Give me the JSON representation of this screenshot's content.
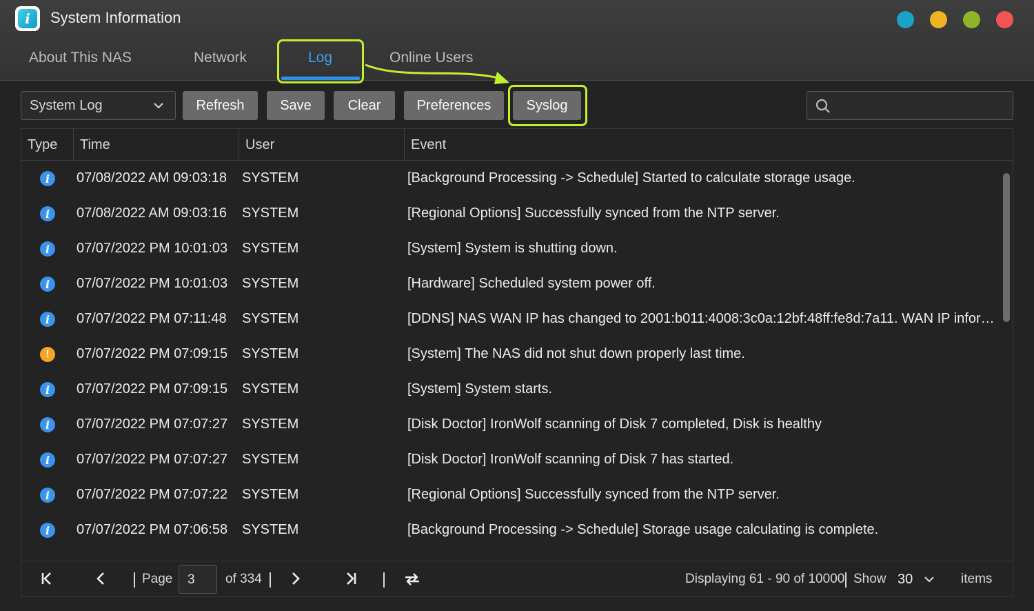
{
  "window": {
    "title": "System Information",
    "controls": [
      {
        "name": "help",
        "color": "#1aa3c7"
      },
      {
        "name": "minimize",
        "color": "#f0b323"
      },
      {
        "name": "maximize",
        "color": "#8fb427"
      },
      {
        "name": "close",
        "color": "#f05454"
      }
    ]
  },
  "tabs": [
    {
      "label": "About This NAS",
      "active": false
    },
    {
      "label": "Network",
      "active": false
    },
    {
      "label": "Log",
      "active": true
    },
    {
      "label": "Online Users",
      "active": false
    }
  ],
  "toolbar": {
    "log_type": "System Log",
    "refresh": "Refresh",
    "save": "Save",
    "clear": "Clear",
    "preferences": "Preferences",
    "syslog": "Syslog",
    "search_placeholder": ""
  },
  "table": {
    "columns": [
      "Type",
      "Time",
      "User",
      "Event"
    ],
    "rows": [
      {
        "type": "info",
        "time": "07/08/2022 AM 09:03:18",
        "user": "SYSTEM",
        "event": "[Background Processing -> Schedule] Started to calculate storage usage."
      },
      {
        "type": "info",
        "time": "07/08/2022 AM 09:03:16",
        "user": "SYSTEM",
        "event": "[Regional Options] Successfully synced from the NTP server."
      },
      {
        "type": "info",
        "time": "07/07/2022 PM 10:01:03",
        "user": "SYSTEM",
        "event": "[System] System is shutting down."
      },
      {
        "type": "info",
        "time": "07/07/2022 PM 10:01:03",
        "user": "SYSTEM",
        "event": "[Hardware] Scheduled system power off."
      },
      {
        "type": "info",
        "time": "07/07/2022 PM 07:11:48",
        "user": "SYSTEM",
        "event": "[DDNS] NAS WAN IP has changed to 2001:b011:4008:3c0a:12bf:48ff:fe8d:7a11. WAN IP informatio..."
      },
      {
        "type": "warning",
        "time": "07/07/2022 PM 07:09:15",
        "user": "SYSTEM",
        "event": "[System] The NAS did not shut down properly last time."
      },
      {
        "type": "info",
        "time": "07/07/2022 PM 07:09:15",
        "user": "SYSTEM",
        "event": "[System] System starts."
      },
      {
        "type": "info",
        "time": "07/07/2022 PM 07:07:27",
        "user": "SYSTEM",
        "event": "[Disk Doctor] IronWolf scanning of Disk 7 completed, Disk is healthy"
      },
      {
        "type": "info",
        "time": "07/07/2022 PM 07:07:27",
        "user": "SYSTEM",
        "event": "[Disk Doctor] IronWolf scanning of Disk 7 has started."
      },
      {
        "type": "info",
        "time": "07/07/2022 PM 07:07:22",
        "user": "SYSTEM",
        "event": "[Regional Options] Successfully synced from the NTP server."
      },
      {
        "type": "info",
        "time": "07/07/2022 PM 07:06:58",
        "user": "SYSTEM",
        "event": "[Background Processing -> Schedule] Storage usage calculating is complete."
      }
    ]
  },
  "pagination": {
    "page_label": "Page",
    "page": "3",
    "of_label": "of 334",
    "displaying": "Displaying 61 - 90 of 10000",
    "show_label": "Show",
    "show_count": "30",
    "items_label": "items"
  },
  "accent": {
    "highlight": "#c2ef2e",
    "active_tab": "#3aa1f2"
  }
}
